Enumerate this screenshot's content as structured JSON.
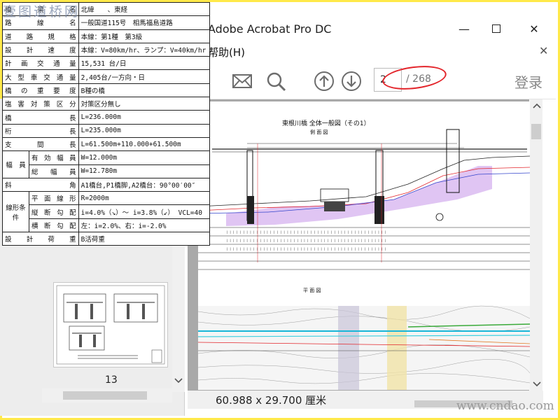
{
  "window": {
    "title": "Adobe Acrobat Pro DC",
    "minimize": "—",
    "maximize": "",
    "close": "✕"
  },
  "menu": {
    "help": "帮助(H)",
    "tab_close": "✕"
  },
  "toolbar": {
    "current_page": "2",
    "total_pages": "/ 268",
    "login": "登录",
    "icons": [
      "print-icon",
      "mail-icon",
      "search-icon",
      "arrow-up-icon",
      "arrow-down-icon"
    ]
  },
  "thumbnails": {
    "page_label": "13"
  },
  "document": {
    "drawing_title": "東根川橋 全体一般図（その1）",
    "side_view_label": "側 面 図",
    "plan_view_label": "平 面 図",
    "page_size": "60.988 x 29.700 厘米"
  },
  "spec_table": {
    "rows": [
      {
        "label": "橋　　梁　　名",
        "value": "北緯　　、東経"
      },
      {
        "label": "路　線　名",
        "value": "一般国道115号　相馬福島道路"
      },
      {
        "label": "道　路　規　格",
        "value": "本線：第1種　第3級"
      },
      {
        "label": "設　計　速　度",
        "value": "本線：V=80km/hr、ランプ：V=40km/hr"
      },
      {
        "label": "計画交通量",
        "value": "15,531 台/日"
      },
      {
        "label": "大型車交通量",
        "value": "2,405台/一方向・日"
      },
      {
        "label": "橋の重要度",
        "value": "B種の橋"
      },
      {
        "label": "塩害対策区分",
        "value": "対策区分無し"
      },
      {
        "label": "橋　　　長",
        "value": "L=236.000m"
      },
      {
        "label": "桁　　　長",
        "value": "L=235.000m"
      },
      {
        "label": "支　　間　　長",
        "value": "L=61.500m+110.000+61.500m"
      }
    ],
    "width_group": {
      "label": "幅　員",
      "rows": [
        {
          "sub": "有効幅員",
          "value": "W=12.000m"
        },
        {
          "sub": "総幅員",
          "value": "W=12.780m"
        }
      ]
    },
    "skew": {
      "label": "斜　　　角",
      "value": "A1橋台,P1橋脚,A2橋台：90°00′00″"
    },
    "alignment_group": {
      "label": "線形条件",
      "rows": [
        {
          "sub": "平面線形",
          "value": "R=2000m"
        },
        {
          "sub": "縦断勾配",
          "value": "i=4.0%（↘）〜 i=3.8%（↙） VCL=40"
        },
        {
          "sub": "横断勾配",
          "value": "左：i=2.0%、右：i=-2.0%"
        }
      ]
    },
    "design_load": {
      "label": "設　計　荷　重",
      "value": "B活荷重"
    }
  },
  "watermarks": {
    "top": "壹图道桥网",
    "bottom": "www.cndao.com"
  },
  "colors": {
    "frame": "#ffe94a",
    "annotation": "#e3252b"
  }
}
